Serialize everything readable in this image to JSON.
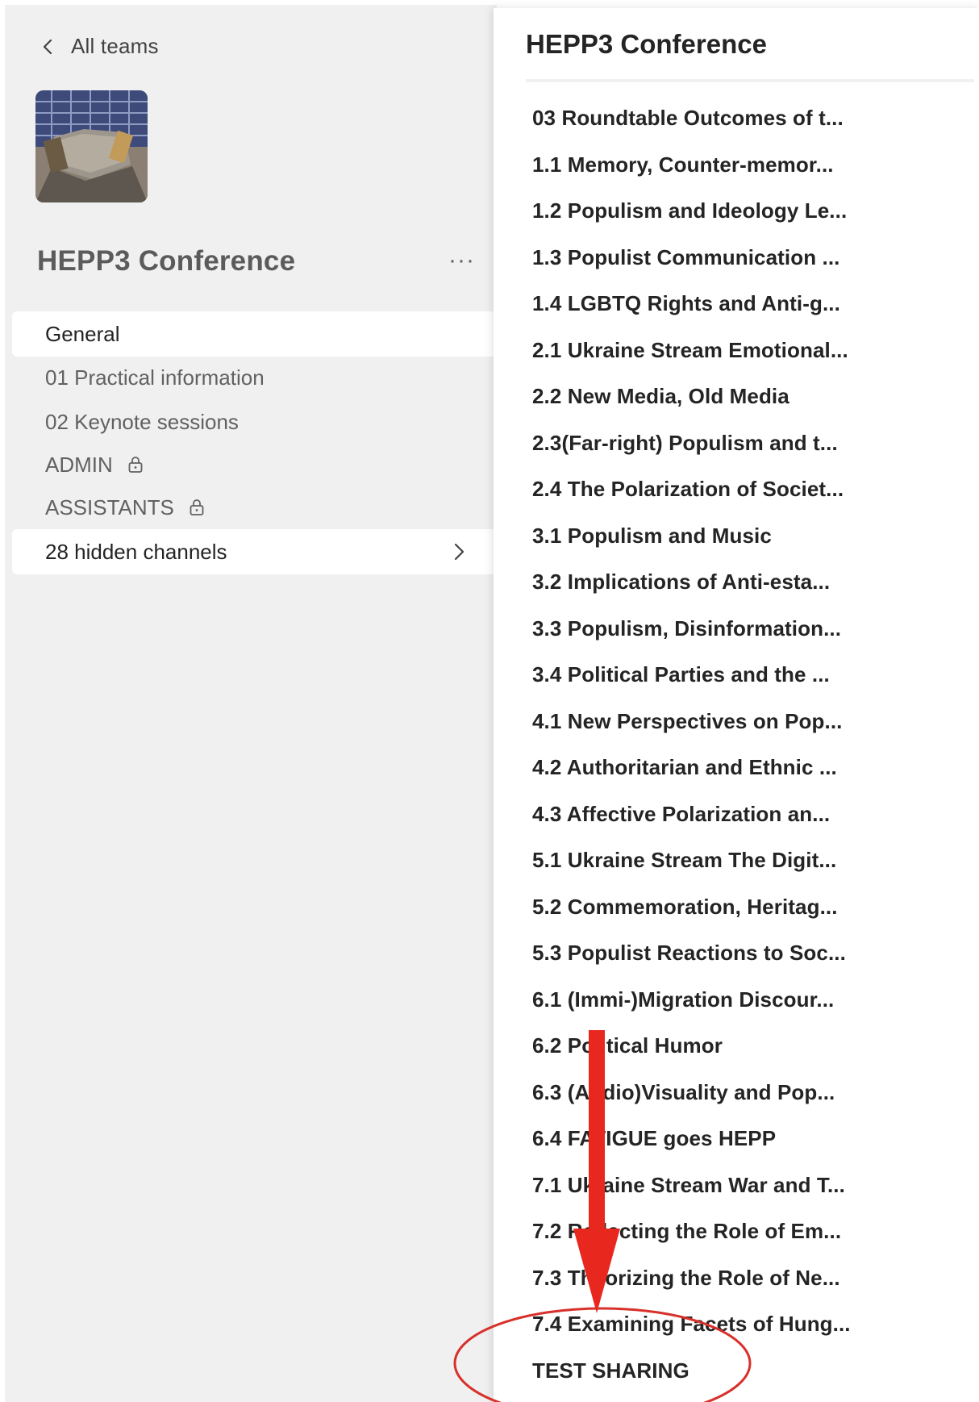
{
  "nav": {
    "back_label": "All teams"
  },
  "team": {
    "name": "HEPP3 Conference",
    "more_label": "···",
    "channels": [
      {
        "label": "General",
        "locked": false
      },
      {
        "label": "01 Practical information",
        "locked": false
      },
      {
        "label": "02 Keynote sessions",
        "locked": false
      },
      {
        "label": "ADMIN",
        "locked": true
      },
      {
        "label": "ASSISTANTS",
        "locked": true
      }
    ],
    "hidden_channels_label": "28 hidden channels"
  },
  "panel": {
    "title": "HEPP3 Conference",
    "channels": [
      "03 Roundtable Outcomes of t...",
      "1.1 Memory, Counter-memor...",
      "1.2 Populism and Ideology Le...",
      "1.3 Populist Communication ...",
      "1.4 LGBTQ Rights and Anti-g...",
      "2.1 Ukraine Stream Emotional...",
      "2.2 New Media, Old Media",
      "2.3(Far-right) Populism and t...",
      "2.4 The Polarization of Societ...",
      "3.1 Populism and Music",
      "3.2 Implications of Anti-esta...",
      "3.3 Populism, Disinformation...",
      "3.4 Political Parties and the ...",
      "4.1 New Perspectives on Pop...",
      "4.2 Authoritarian and Ethnic ...",
      "4.3 Affective Polarization an...",
      "5.1 Ukraine Stream The Digit...",
      "5.2 Commemoration, Heritag...",
      "5.3 Populist Reactions to Soc...",
      "6.1 (Immi-)Migration Discour...",
      "6.2 Political Humor",
      "6.3 (Audio)Visuality and Pop...",
      "6.4 FATIGUE goes HEPP",
      "7.1 Ukraine Stream War and T...",
      "7.2 Reflecting the Role of Em...",
      "7.3 Theorizing the Role of Ne...",
      "7.4 Examining Facets of Hung...",
      "TEST SHARING"
    ]
  },
  "annotation": {
    "arrow_color": "#e8281f",
    "ellipse_color": "#d8302a"
  }
}
